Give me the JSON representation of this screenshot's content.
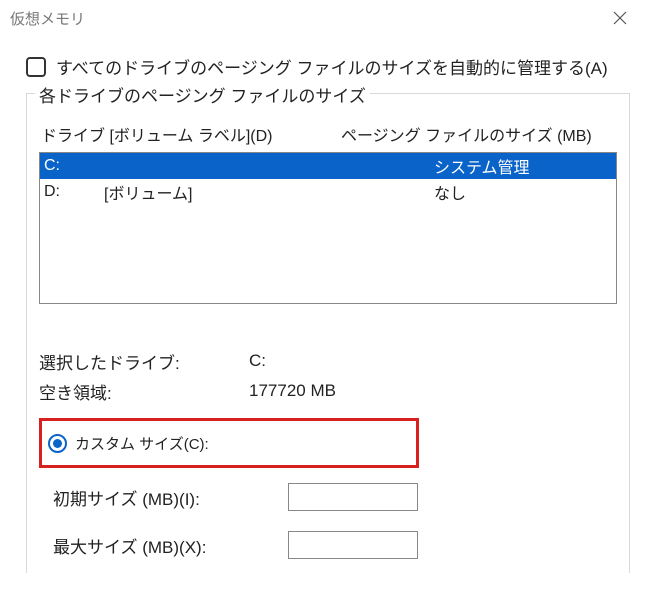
{
  "window": {
    "title": "仮想メモリ"
  },
  "auto_manage_checkbox": {
    "label": "すべてのドライブのページング ファイルのサイズを自動的に管理する(A)",
    "checked": false
  },
  "group": {
    "legend": "各ドライブのページング ファイルのサイズ",
    "header_drive": "ドライブ  [ボリューム ラベル](D)",
    "header_size": "ページング ファイルのサイズ (MB)",
    "drives": [
      {
        "drive": "C:",
        "label": "",
        "size": "システム管理",
        "selected": true
      },
      {
        "drive": "D:",
        "label": "[ボリューム]",
        "size": "なし",
        "selected": false
      }
    ]
  },
  "info": {
    "selected_drive_label": "選択したドライブ:",
    "selected_drive_value": "C:",
    "free_space_label": "空き領域:",
    "free_space_value": "177720 MB"
  },
  "custom_size": {
    "radio_label": "カスタム サイズ(C):",
    "radio_selected": true,
    "initial_label": "初期サイズ (MB)(I):",
    "initial_value": "",
    "max_label": "最大サイズ (MB)(X):",
    "max_value": ""
  }
}
